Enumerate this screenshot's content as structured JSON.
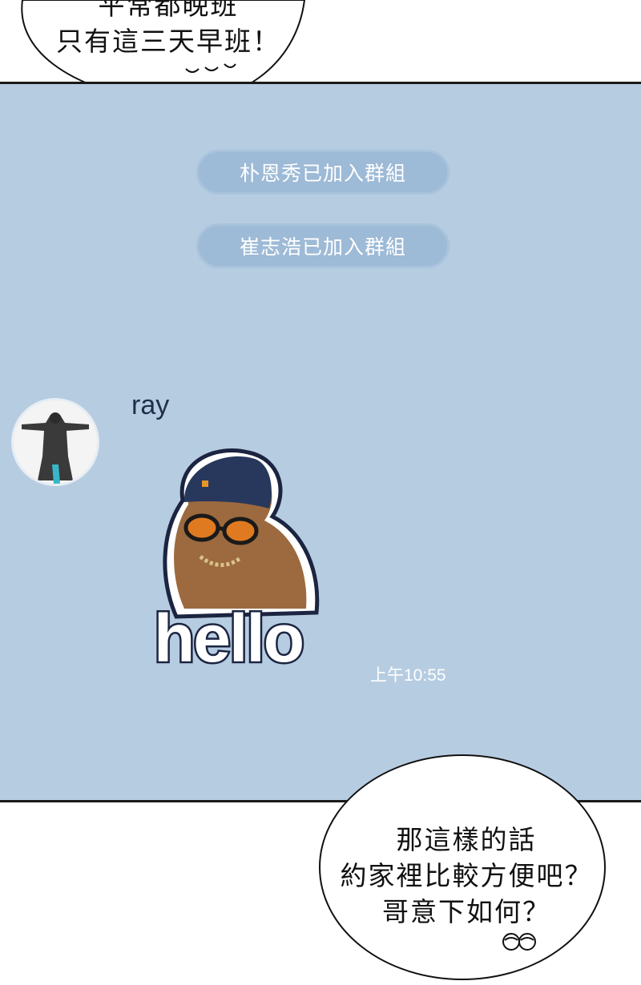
{
  "top_bubble": {
    "line1": "平常都晚班",
    "line2": "只有這三天早班！",
    "doodle": "ᴗᴗ"
  },
  "chat": {
    "system_notices": [
      "朴恩秀已加入群組",
      "崔志浩已加入群組"
    ],
    "message": {
      "sender": "ray",
      "avatar_icon": "statue-avatar-icon",
      "sticker_icon": "bear-sticker-icon",
      "sticker_text": "hello",
      "time": "上午10:55"
    },
    "background_color": "#b6cce1",
    "notice_color": "#9dbad6"
  },
  "bottom_bubble": {
    "line1": "那這樣的話",
    "line2": "約家裡比較方便吧？",
    "line3": "哥意下如何？"
  }
}
